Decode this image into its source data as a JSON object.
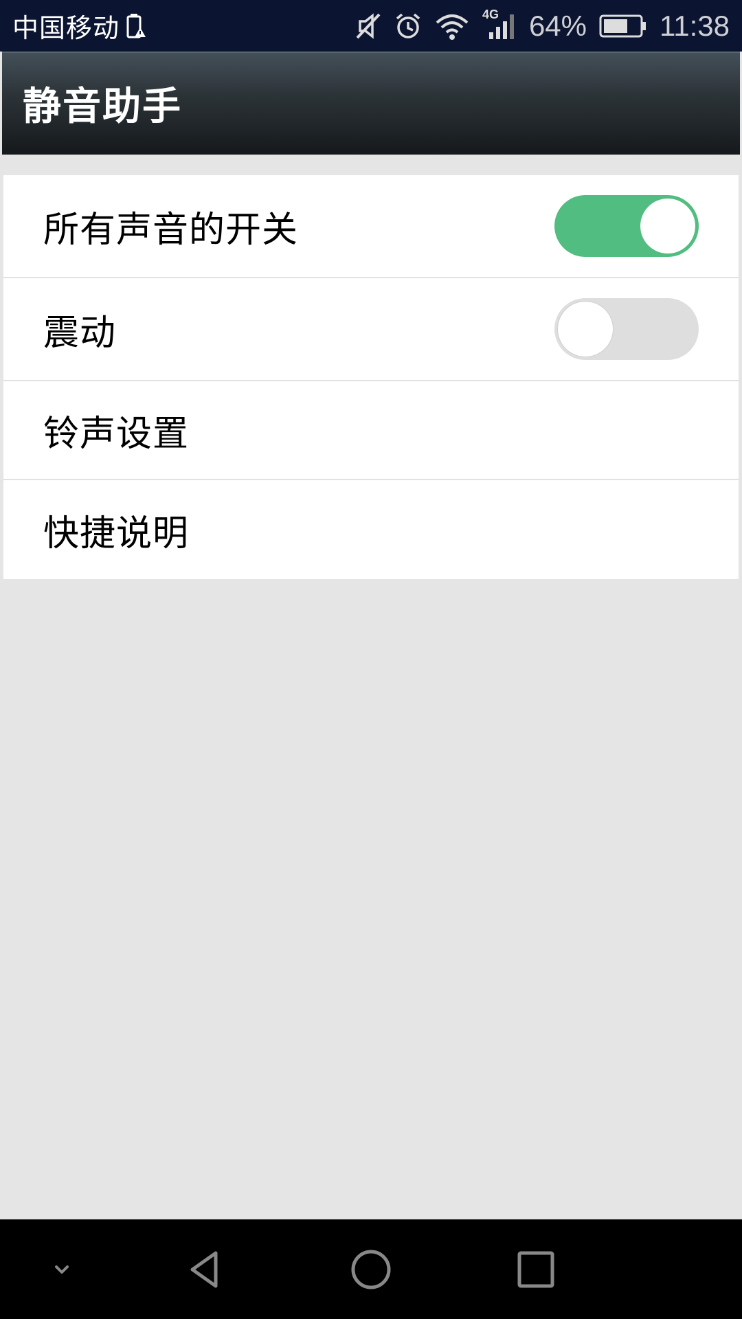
{
  "status_bar": {
    "carrier": "中国移动",
    "battery_percent": "64%",
    "time": "11:38",
    "network_type": "4G",
    "icons": [
      "battery-alert-icon",
      "mute-icon",
      "alarm-icon",
      "wifi-icon",
      "signal-icon",
      "battery-icon"
    ]
  },
  "app_bar": {
    "title": "静音助手"
  },
  "settings": {
    "items": [
      {
        "label": "所有声音的开关",
        "toggle": true
      },
      {
        "label": "震动",
        "toggle": false
      },
      {
        "label": "铃声设置"
      },
      {
        "label": "快捷说明"
      }
    ]
  },
  "nav_bar": {
    "buttons": [
      "collapse-icon",
      "back-icon",
      "home-icon",
      "recents-icon"
    ]
  },
  "colors": {
    "toggle_on": "#52bd80",
    "toggle_off": "#dedede",
    "status_bar": "#0b1430",
    "background": "#e5e5e5"
  }
}
